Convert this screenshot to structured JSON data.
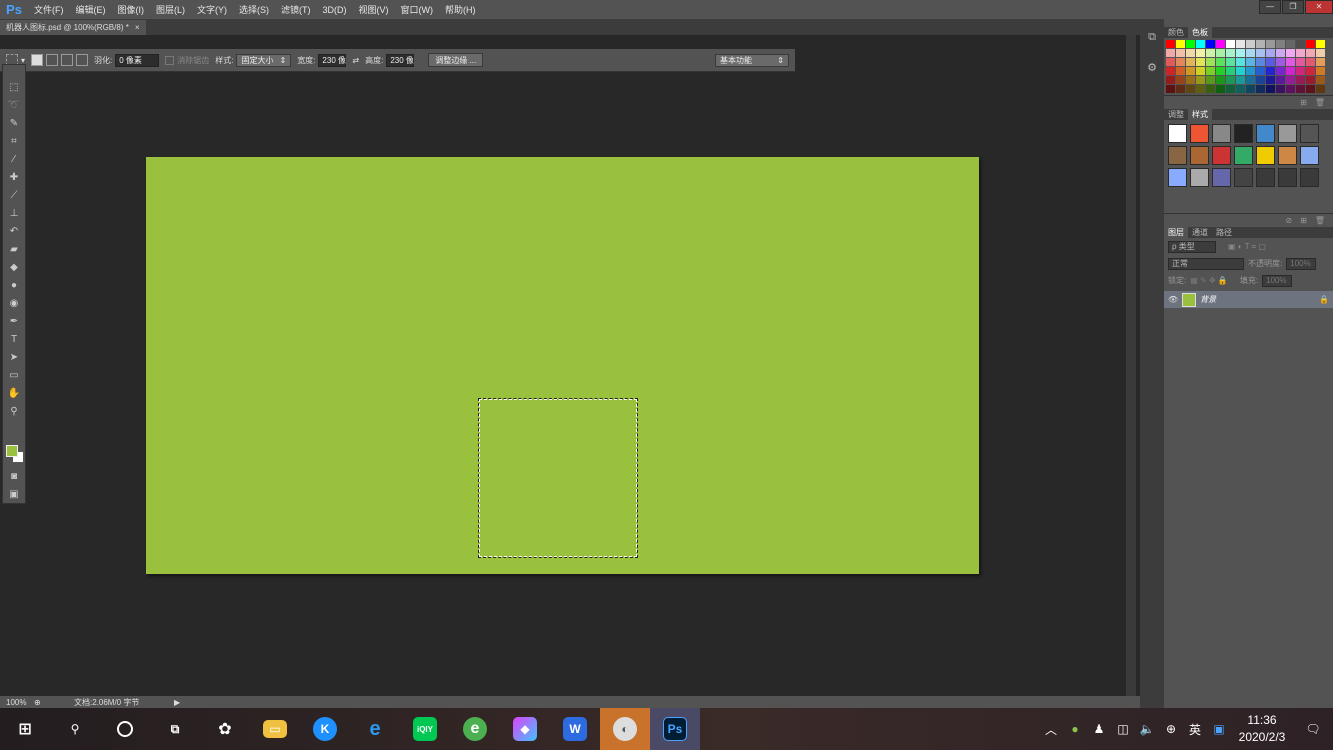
{
  "app": {
    "logo": "Ps"
  },
  "menu": [
    "文件(F)",
    "编辑(E)",
    "图像(I)",
    "图层(L)",
    "文字(Y)",
    "选择(S)",
    "滤镜(T)",
    "3D(D)",
    "视图(V)",
    "窗口(W)",
    "帮助(H)"
  ],
  "window_controls": {
    "min": "—",
    "max": "❐",
    "close": "✕"
  },
  "doc_tab": {
    "title": "机器人图标.psd @ 100%(RGB/8) *",
    "close": "×"
  },
  "options": {
    "feather_label": "羽化:",
    "feather_value": "0 像素",
    "antialias_label": "消除锯齿",
    "style_label": "样式:",
    "style_value": "固定大小",
    "width_label": "宽度:",
    "width_value": "230 像",
    "height_label": "高度:",
    "height_value": "230 像",
    "refine_button": "调整边缘 ...",
    "workspace": "基本功能"
  },
  "tools": [
    "marquee-icon",
    "lasso-icon",
    "quick-select-icon",
    "crop-icon",
    "eyedropper-icon",
    "healing-icon",
    "brush-icon",
    "stamp-icon",
    "history-brush-icon",
    "eraser-icon",
    "paint-bucket-icon",
    "blur-icon",
    "dodge-icon",
    "pen-icon",
    "type-icon",
    "path-select-icon",
    "shape-icon",
    "hand-icon",
    "zoom-icon"
  ],
  "colors": {
    "foreground": "#9ac13e",
    "background": "#ffffff",
    "canvas": "#9ac13e",
    "accent": "#4aa3ff"
  },
  "panels": {
    "color_tabs": [
      "颜色",
      "色板"
    ],
    "adjust_tabs": [
      "调整",
      "样式"
    ],
    "layers_tabs": [
      "图层",
      "通道",
      "路径"
    ],
    "kind_filter": "ρ 类型",
    "blend_mode": "正常",
    "opacity_label": "不透明度:",
    "opacity_value": "100%",
    "lock_label": "锁定:",
    "fill_label": "填充:",
    "fill_value": "100%",
    "layer_name": "背景"
  },
  "status": {
    "zoom": "100%",
    "doc_info": "文档:2.06M/0 字节"
  },
  "taskbar": {
    "apps": [
      "windows-start-icon",
      "search-icon",
      "cortana-icon",
      "task-view-icon",
      "pinwheel-app-icon",
      "file-explorer-icon",
      "kugou-icon",
      "edge-icon",
      "iqiyi-icon",
      "browser-icon",
      "game-icon",
      "wps-icon",
      "image-viewer-icon",
      "photoshop-icon"
    ],
    "ps_label": "Ps",
    "tray_lang": "英",
    "time": "11:36",
    "date": "2020/2/3"
  }
}
